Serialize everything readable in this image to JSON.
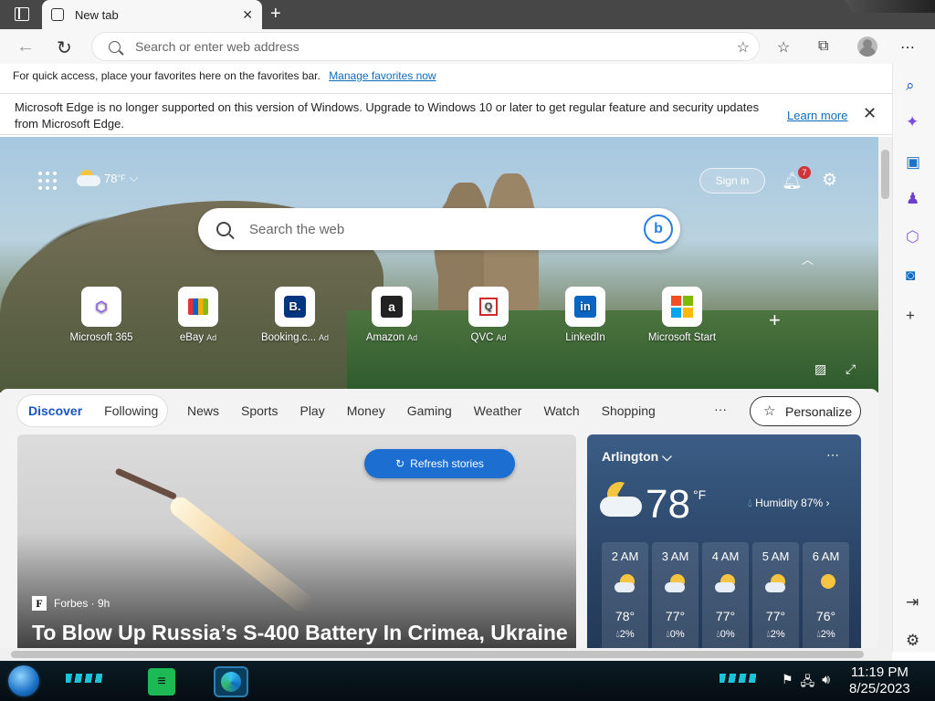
{
  "browser": {
    "tab_title": "New tab",
    "address_placeholder": "Search or enter web address"
  },
  "favorites_bar": {
    "message": "For quick access, place your favorites here on the favorites bar.",
    "link": "Manage favorites now"
  },
  "infobar": {
    "message": "Microsoft Edge is no longer supported on this version of Windows. Upgrade to Windows 10 or later to get regular feature and security updates from Microsoft Edge.",
    "link": "Learn more"
  },
  "hero": {
    "weather_temp": "78",
    "weather_unit": "°F",
    "sign_in": "Sign in",
    "notification_count": "7",
    "search_placeholder": "Search the web",
    "quick_links": [
      {
        "label": "Microsoft 365",
        "ad": "",
        "icon": "microsoft365-icon"
      },
      {
        "label": "eBay",
        "ad": "Ad",
        "icon": "ebay-icon"
      },
      {
        "label": "Booking.c...",
        "ad": "Ad",
        "icon": "booking-icon"
      },
      {
        "label": "Amazon",
        "ad": "Ad",
        "icon": "amazon-icon"
      },
      {
        "label": "QVC",
        "ad": "Ad",
        "icon": "qvc-icon"
      },
      {
        "label": "LinkedIn",
        "ad": "",
        "icon": "linkedin-icon"
      },
      {
        "label": "Microsoft Start",
        "ad": "",
        "icon": "microsoft-start-icon"
      }
    ]
  },
  "feed": {
    "toggle": [
      "Discover",
      "Following"
    ],
    "nav": [
      "News",
      "Sports",
      "Play",
      "Money",
      "Gaming",
      "Weather",
      "Watch",
      "Shopping"
    ],
    "more": "···",
    "personalize": "Personalize"
  },
  "story": {
    "refresh": "Refresh stories",
    "source": "Forbes · 9h",
    "headline": "To Blow Up Russia’s S-400 Battery In Crimea, Ukraine"
  },
  "weather_card": {
    "city": "Arlington",
    "temp": "78",
    "unit": "°F",
    "humidity": "Humidity 87%",
    "hours": [
      {
        "time": "2 AM",
        "temp": "78°",
        "precip": "2%"
      },
      {
        "time": "3 AM",
        "temp": "77°",
        "precip": "0%"
      },
      {
        "time": "4 AM",
        "temp": "77°",
        "precip": "0%"
      },
      {
        "time": "5 AM",
        "temp": "77°",
        "precip": "2%"
      },
      {
        "time": "6 AM",
        "temp": "76°",
        "precip": "2%"
      }
    ]
  },
  "taskbar": {
    "time": "11:19 PM",
    "date": "8/25/2023"
  },
  "colors": {
    "accent": "#1c6fd1",
    "link": "#0f6cbd",
    "titlebar": "#474747"
  }
}
